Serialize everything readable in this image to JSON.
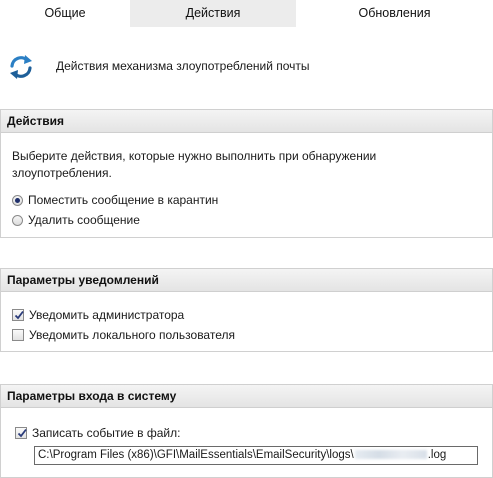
{
  "tabs": [
    {
      "label": "Общие"
    },
    {
      "label": "Действия"
    },
    {
      "label": "Обновления"
    }
  ],
  "header": {
    "icon": "refresh-arrows-icon",
    "title": "Действия механизма злоупотреблений почты"
  },
  "actions": {
    "title": "Действия",
    "description": "Выберите действия, которые нужно выполнить при обнаружении злоупотребления.",
    "options": [
      {
        "label": "Поместить сообщение в карантин",
        "selected": true
      },
      {
        "label": "Удалить сообщение",
        "selected": false
      }
    ]
  },
  "notifications": {
    "title": "Параметры уведомлений",
    "options": [
      {
        "label": "Уведомить администратора",
        "checked": true
      },
      {
        "label": "Уведомить локального пользователя",
        "checked": false
      }
    ]
  },
  "logging": {
    "title": "Параметры входа в систему",
    "checkbox_label": "Записать событие в файл:",
    "checked": true,
    "path_prefix": "C:\\Program Files (x86)\\GFI\\MailEssentials\\EmailSecurity\\logs\\",
    "path_suffix": ".log"
  },
  "colors": {
    "active_tab": "#ececec",
    "section_border": "#d0d0d0",
    "radio_dot": "#1f2f6b",
    "icon_blue": "#2b7fc4"
  }
}
